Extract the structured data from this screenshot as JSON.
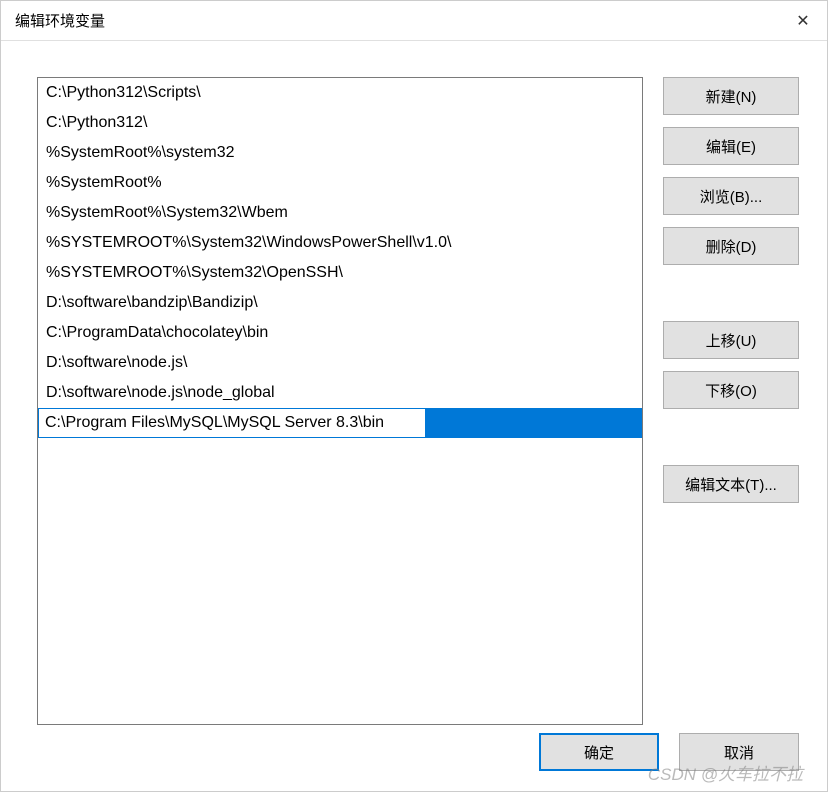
{
  "window": {
    "title": "编辑环境变量",
    "close_icon": "✕"
  },
  "list": {
    "items": [
      "C:\\Python312\\Scripts\\",
      "C:\\Python312\\",
      "%SystemRoot%\\system32",
      "%SystemRoot%",
      "%SystemRoot%\\System32\\Wbem",
      "%SYSTEMROOT%\\System32\\WindowsPowerShell\\v1.0\\",
      "%SYSTEMROOT%\\System32\\OpenSSH\\",
      "D:\\software\\bandzip\\Bandizip\\",
      "C:\\ProgramData\\chocolatey\\bin",
      "D:\\software\\node.js\\",
      "D:\\software\\node.js\\node_global"
    ],
    "editing_value": "C:\\Program Files\\MySQL\\MySQL Server 8.3\\bin"
  },
  "buttons": {
    "new": "新建(N)",
    "edit": "编辑(E)",
    "browse": "浏览(B)...",
    "delete": "删除(D)",
    "move_up": "上移(U)",
    "move_down": "下移(O)",
    "edit_text": "编辑文本(T)...",
    "ok": "确定",
    "cancel": "取消"
  },
  "watermark": "CSDN @火车拉不拉"
}
